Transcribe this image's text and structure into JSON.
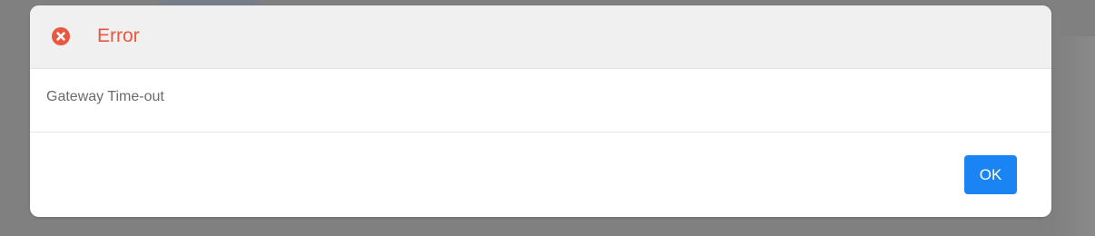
{
  "dialog": {
    "title": "Error",
    "icon": "error-circle-x-icon",
    "message": "Gateway Time-out",
    "ok_label": "OK"
  },
  "colors": {
    "title": "#e8573f",
    "icon": "#e8573f",
    "button": "#1b84f5",
    "header_bg": "#f0f0f0",
    "message": "#6b6b6b",
    "overlay": "#808080"
  }
}
